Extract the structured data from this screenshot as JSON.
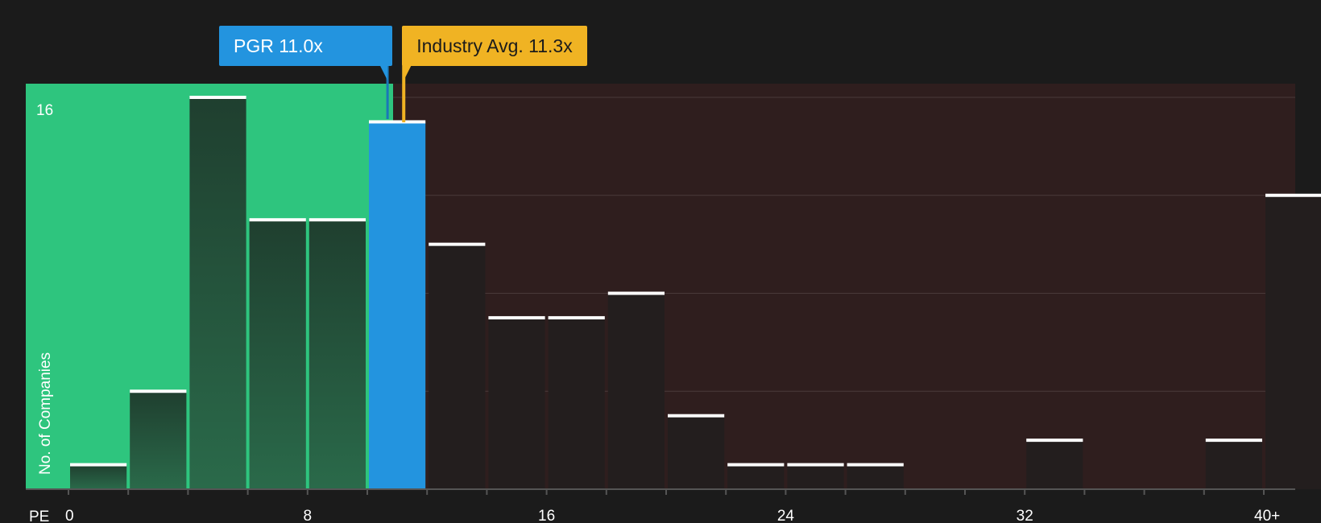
{
  "chart_data": {
    "type": "bar",
    "xlabel": "PE",
    "ylabel": "No. of Companies",
    "x_ticks": [
      "0",
      "8",
      "16",
      "24",
      "32",
      "40+"
    ],
    "y_ticks": [
      "16"
    ],
    "ylim": [
      0,
      16
    ],
    "bins": [
      {
        "from": 0,
        "to": 2,
        "count": 1
      },
      {
        "from": 2,
        "to": 4,
        "count": 4
      },
      {
        "from": 4,
        "to": 6,
        "count": 16
      },
      {
        "from": 6,
        "to": 8,
        "count": 11
      },
      {
        "from": 8,
        "to": 10,
        "count": 11
      },
      {
        "from": 10,
        "to": 12,
        "count": 15
      },
      {
        "from": 12,
        "to": 14,
        "count": 10
      },
      {
        "from": 14,
        "to": 16,
        "count": 7
      },
      {
        "from": 16,
        "to": 18,
        "count": 7
      },
      {
        "from": 18,
        "to": 20,
        "count": 8
      },
      {
        "from": 20,
        "to": 22,
        "count": 3
      },
      {
        "from": 22,
        "to": 24,
        "count": 1
      },
      {
        "from": 24,
        "to": 26,
        "count": 1
      },
      {
        "from": 26,
        "to": 28,
        "count": 1
      },
      {
        "from": 28,
        "to": 30,
        "count": 0
      },
      {
        "from": 30,
        "to": 32,
        "count": 0
      },
      {
        "from": 32,
        "to": 34,
        "count": 2
      },
      {
        "from": 34,
        "to": 36,
        "count": 0
      },
      {
        "from": 36,
        "to": 38,
        "count": 0
      },
      {
        "from": 38,
        "to": 40,
        "count": 2
      },
      {
        "from": 40,
        "to": 42,
        "count": 12
      }
    ],
    "company": {
      "label": "PGR",
      "value_text": "11.0x",
      "value": 11.0,
      "color": "#2394df"
    },
    "industry": {
      "label": "Industry Avg.",
      "value_text": "11.3x",
      "value": 11.3,
      "color": "#f0b323"
    },
    "colors": {
      "background": "#1b1b1b",
      "undervalued_zone": "#2ec57e",
      "overvalued_zone": "#2f1e1e",
      "bar_in_green": "#234a37",
      "bar_in_red": "#231e1e",
      "highlight_bar": "#2394df",
      "bar_cap": "#ffffff",
      "grid": "#4a3a3a"
    }
  }
}
